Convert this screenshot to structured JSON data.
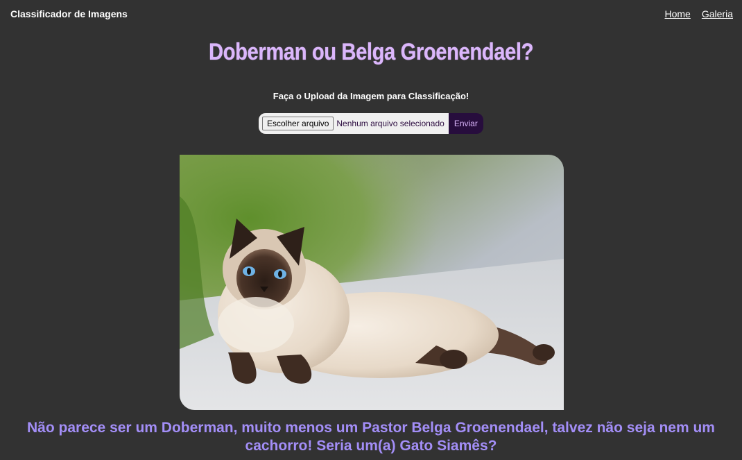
{
  "navbar": {
    "brand": "Classificador de Imagens",
    "links": [
      "Home",
      "Galeria"
    ]
  },
  "page": {
    "title": "Doberman ou Belga Groenendael?",
    "subtitle": "Faça o Upload da Imagem para Classificação!"
  },
  "upload": {
    "choose_file_label": "Escolher arquivo",
    "file_status": "Nenhum arquivo selecionado",
    "submit_label": "Enviar"
  },
  "image": {
    "subject": "siamese-cat-photo"
  },
  "result": {
    "line1": "Não parece ser um Doberman, muito menos um Pastor Belga Groenendael, talvez não seja nem um",
    "line2": "cachorro! Seria um(a) Gato Siamês?"
  },
  "colors": {
    "background": "#323232",
    "title": "#dbb6fb",
    "result": "#a38ef7",
    "submit_bg": "#270d3d"
  }
}
